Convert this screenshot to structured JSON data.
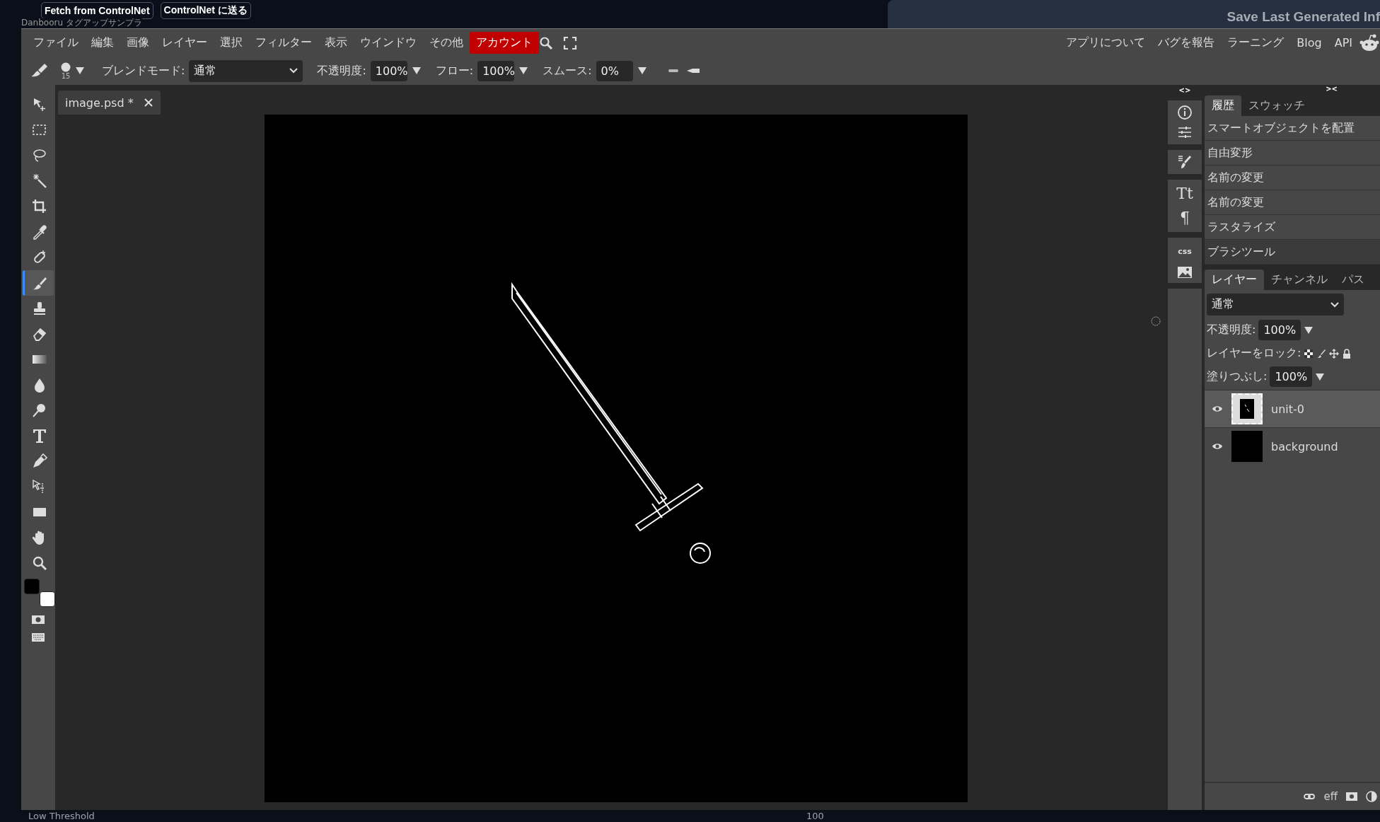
{
  "top_buttons": [
    "Fetch from ControlNet",
    "ControlNet に送る"
  ],
  "background_label": "Danbooru タグアップサンプラ",
  "side_button": "Save Last Generated Inf",
  "menu": [
    {
      "label": "ファイル",
      "highlighted": false
    },
    {
      "label": "編集",
      "highlighted": false
    },
    {
      "label": "画像",
      "highlighted": false
    },
    {
      "label": "レイヤー",
      "highlighted": false
    },
    {
      "label": "選択",
      "highlighted": false
    },
    {
      "label": "フィルター",
      "highlighted": false
    },
    {
      "label": "表示",
      "highlighted": false
    },
    {
      "label": "ウインドウ",
      "highlighted": false
    },
    {
      "label": "その他",
      "highlighted": false
    },
    {
      "label": "アカウント",
      "highlighted": true
    }
  ],
  "right_links": [
    "アプリについて",
    "バグを報告",
    "ラーニング",
    "Blog",
    "API"
  ],
  "options": {
    "brush_size": "15",
    "blend_label": "ブレンドモード:",
    "blend_value": "通常",
    "opacity_label": "不透明度:",
    "opacity": "100%",
    "flow_label": "フロー:",
    "flow": "100%",
    "smooth_label": "スムース:",
    "smooth": "0%"
  },
  "tools": [
    {
      "kind": "move",
      "selected": false
    },
    {
      "kind": "marquee",
      "selected": false
    },
    {
      "kind": "lasso",
      "selected": false
    },
    {
      "kind": "wand",
      "selected": false
    },
    {
      "kind": "crop",
      "selected": false
    },
    {
      "kind": "eyedropper",
      "selected": false
    },
    {
      "kind": "heal",
      "selected": false
    },
    {
      "kind": "brush",
      "selected": true
    },
    {
      "kind": "stamp",
      "selected": false
    },
    {
      "kind": "eraser",
      "selected": false
    },
    {
      "kind": "gradient",
      "selected": false
    },
    {
      "kind": "blur",
      "selected": false
    },
    {
      "kind": "dodge",
      "selected": false
    },
    {
      "kind": "type",
      "selected": false
    },
    {
      "kind": "pen",
      "selected": false
    },
    {
      "kind": "select",
      "selected": false
    },
    {
      "kind": "shape",
      "selected": false
    },
    {
      "kind": "hand",
      "selected": false
    },
    {
      "kind": "zoom",
      "selected": false
    }
  ],
  "document_tab": {
    "title": "image.psd *"
  },
  "collapse_marks": [
    "<>",
    "><"
  ],
  "side_glyphs": [
    "Tt",
    "¶",
    "css"
  ],
  "history": {
    "tabs": [
      {
        "label": "履歴",
        "selected": true
      },
      {
        "label": "スウォッチ",
        "selected": false
      }
    ],
    "items": [
      {
        "label": "スマートオブジェクトを配置",
        "selected": false
      },
      {
        "label": "自由変形",
        "selected": false
      },
      {
        "label": "名前の変更",
        "selected": false
      },
      {
        "label": "名前の変更",
        "selected": false
      },
      {
        "label": "ラスタライズ",
        "selected": false
      },
      {
        "label": "ブラシツール",
        "selected": true
      }
    ]
  },
  "layers_panel": {
    "tabs": [
      {
        "label": "レイヤー",
        "selected": true
      },
      {
        "label": "チャンネル",
        "selected": false
      },
      {
        "label": "パス",
        "selected": false
      }
    ],
    "blend": "通常",
    "opacity_label": "不透明度:",
    "opacity": "100%",
    "lock_label": "レイヤーをロック:",
    "fill_label": "塗りつぶし:",
    "fill": "100%",
    "layers": [
      {
        "name": "unit-0",
        "selected": true,
        "visible": true,
        "kind": "sketch"
      },
      {
        "name": "background",
        "selected": false,
        "visible": true,
        "kind": "solid"
      }
    ],
    "effects_label": "eff"
  },
  "bottom": {
    "label": "Low Threshold",
    "value": "100"
  }
}
